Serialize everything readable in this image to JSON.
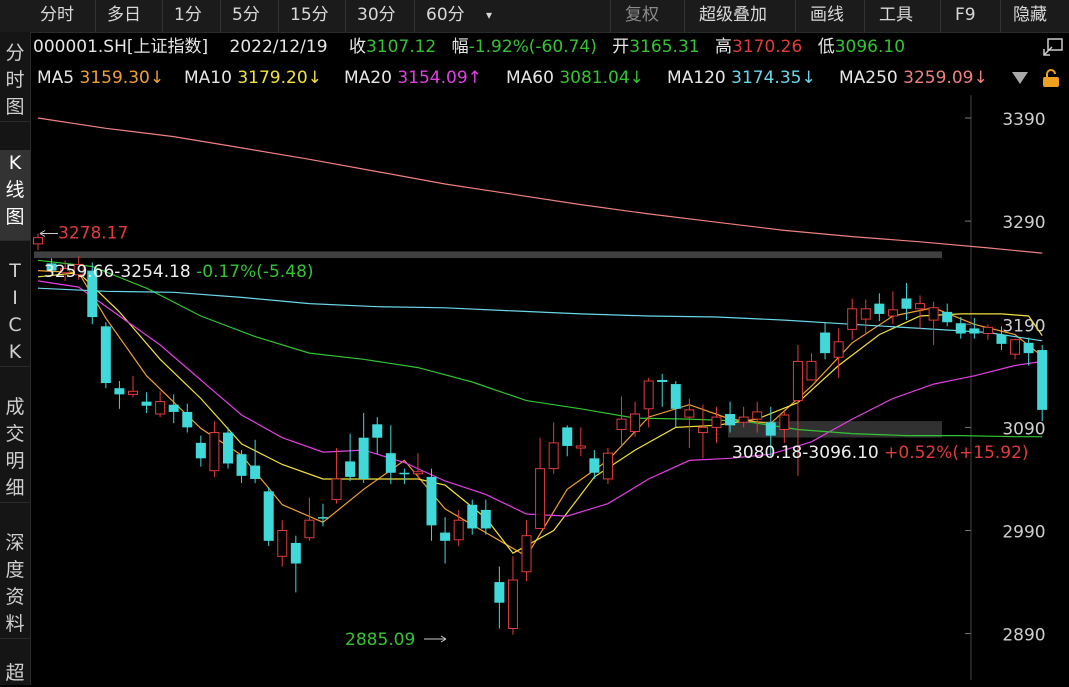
{
  "toolbar": {
    "items": [
      "分时",
      "多日",
      "1分",
      "5分",
      "15分",
      "30分",
      "60分"
    ],
    "dropdown_icon": "caret-down-icon",
    "right_items": [
      "复权",
      "超级叠加",
      "画线",
      "工具",
      "F9",
      "隐藏"
    ]
  },
  "sidebar": {
    "tabs": [
      "分\n时\n图",
      "K\n线\n图",
      "T\nI\nC\nK",
      "成\n交\n明\n细",
      "深\n度\n资\n料",
      "超"
    ]
  },
  "header": {
    "code": "000001.SH[上证指数]",
    "date": "2022/12/19",
    "close_label": "收",
    "close": "3107.12",
    "change_label": "幅",
    "change": "-1.92%(-60.74)",
    "open_label": "开",
    "open": "3165.31",
    "high_label": "高",
    "high": "3170.26",
    "low_label": "低",
    "low": "3096.10",
    "restore_icon": "restore-window-icon"
  },
  "ma_bar": {
    "items": [
      {
        "label": "MA5",
        "value": "3159.30↓",
        "color": "#f0a030"
      },
      {
        "label": "MA10",
        "value": "3179.20↓",
        "color": "#f2e23c"
      },
      {
        "label": "MA20",
        "value": "3154.09↑",
        "color": "#e040e0"
      },
      {
        "label": "MA60",
        "value": "3081.04↓",
        "color": "#33c333"
      },
      {
        "label": "MA120",
        "value": "3174.35↓",
        "color": "#6ad8e8"
      },
      {
        "label": "MA250",
        "value": "3259.09↓",
        "color": "#f08080"
      }
    ],
    "menu_icon": "triangle-down-icon",
    "lock_icon": "lock-icon"
  },
  "colors": {
    "up": "#e03c3c",
    "down": "#40d8d8",
    "background": "#000000"
  },
  "chart_data": {
    "type": "candlestick",
    "yticks": [
      3390,
      3290,
      3190,
      3090,
      2990,
      2890
    ],
    "ylim": [
      2870,
      3405
    ],
    "annotations": {
      "high_marker": "3278.17",
      "low_marker": "2885.09",
      "upper_range": "3259.66-3254.18",
      "upper_pct": "-0.17%(-5.48)",
      "lower_range": "3080.18-3096.10",
      "lower_pct": "+0.52%(+15.92)"
    },
    "band_levels": [
      3259.66,
      3254.18,
      3096.1,
      3080.18
    ],
    "candles": [
      [
        3268,
        3274,
        3278,
        3262
      ],
      [
        3249,
        3242,
        3254,
        3240
      ],
      [
        3240,
        3244,
        3252,
        3232
      ],
      [
        3238,
        3248,
        3256,
        3233
      ],
      [
        3242,
        3197,
        3250,
        3190
      ],
      [
        3188,
        3133,
        3192,
        3128
      ],
      [
        3128,
        3122,
        3135,
        3108
      ],
      [
        3122,
        3125,
        3140,
        3119
      ],
      [
        3115,
        3111,
        3124,
        3104
      ],
      [
        3103,
        3115,
        3125,
        3100
      ],
      [
        3112,
        3105,
        3122,
        3094
      ],
      [
        3105,
        3090,
        3113,
        3085
      ],
      [
        3075,
        3060,
        3082,
        3052
      ],
      [
        3048,
        3085,
        3096,
        3042
      ],
      [
        3085,
        3055,
        3090,
        3050
      ],
      [
        3064,
        3043,
        3068,
        3036
      ],
      [
        3053,
        3040,
        3078,
        3036
      ],
      [
        3028,
        2980,
        3032,
        2975
      ],
      [
        2965,
        2990,
        3000,
        2955
      ],
      [
        2978,
        2958,
        2985,
        2930
      ],
      [
        2983,
        3000,
        3022,
        2980
      ],
      [
        3003,
        3002,
        3016,
        2994
      ],
      [
        3020,
        3040,
        3070,
        3016
      ],
      [
        3057,
        3042,
        3084,
        3038
      ],
      [
        3080,
        3040,
        3104,
        3036
      ],
      [
        3093,
        3080,
        3100,
        3064
      ],
      [
        3065,
        3046,
        3092,
        3035
      ],
      [
        3046,
        3045,
        3050,
        3035
      ],
      [
        3045,
        3047,
        3065,
        3039
      ],
      [
        3042,
        2995,
        3050,
        2980
      ],
      [
        2988,
        2980,
        3003,
        2958
      ],
      [
        2981,
        3000,
        3010,
        2975
      ],
      [
        3015,
        2992,
        3020,
        2986
      ],
      [
        3010,
        2992,
        3020,
        2986
      ],
      [
        2940,
        2920,
        2955,
        2895
      ],
      [
        2895,
        2942,
        2965,
        2889
      ],
      [
        2950,
        2985,
        3000,
        2941
      ],
      [
        2992,
        3050,
        3080,
        3001
      ],
      [
        3050,
        3075,
        3095,
        3045
      ],
      [
        3090,
        3072,
        3092,
        3062
      ],
      [
        3070,
        3072,
        3090,
        3062
      ],
      [
        3060,
        3046,
        3068,
        3040
      ],
      [
        3040,
        3065,
        3070,
        3035
      ],
      [
        3088,
        3098,
        3120,
        3072
      ],
      [
        3086,
        3103,
        3115,
        3081
      ],
      [
        3108,
        3135,
        3138,
        3090
      ],
      [
        3136,
        3134,
        3142,
        3110
      ],
      [
        3132,
        3108,
        3135,
        3090
      ],
      [
        3100,
        3107,
        3118,
        3070
      ],
      [
        3085,
        3090,
        3112,
        3060
      ],
      [
        3090,
        3100,
        3110,
        3075
      ],
      [
        3103,
        3092,
        3115,
        3085
      ],
      [
        3095,
        3100,
        3110,
        3090
      ],
      [
        3098,
        3105,
        3115,
        3085
      ],
      [
        3095,
        3082,
        3110,
        3062
      ],
      [
        3088,
        3102,
        3105,
        3075
      ],
      [
        3116,
        3154,
        3170,
        3043
      ],
      [
        3136,
        3154,
        3162,
        3140
      ],
      [
        3182,
        3162,
        3192,
        3156
      ],
      [
        3158,
        3173,
        3186,
        3138
      ],
      [
        3185,
        3205,
        3215,
        3175
      ],
      [
        3195,
        3205,
        3214,
        3180
      ],
      [
        3210,
        3200,
        3220,
        3193
      ],
      [
        3198,
        3204,
        3222,
        3190
      ],
      [
        3215,
        3205,
        3230,
        3194
      ],
      [
        3205,
        3210,
        3218,
        3185
      ],
      [
        3194,
        3206,
        3212,
        3170
      ],
      [
        3202,
        3192,
        3210,
        3188
      ],
      [
        3191,
        3181,
        3197,
        3176
      ],
      [
        3186,
        3181,
        3196,
        3176
      ],
      [
        3181,
        3187,
        3190,
        3175
      ],
      [
        3180,
        3171,
        3188,
        3165
      ],
      [
        3161,
        3175,
        3176,
        3156
      ],
      [
        3172,
        3162,
        3177,
        3150
      ],
      [
        3165,
        3107,
        3170,
        3096
      ]
    ],
    "ma": {
      "MA5": [
        [
          0,
          3242
        ],
        [
          3,
          3240
        ],
        [
          5,
          3196
        ],
        [
          8,
          3140
        ],
        [
          12,
          3089
        ],
        [
          15,
          3063
        ],
        [
          18,
          3015
        ],
        [
          21,
          2998
        ],
        [
          24,
          3030
        ],
        [
          27,
          3058
        ],
        [
          30,
          3011
        ],
        [
          33,
          2988
        ],
        [
          36,
          2965
        ],
        [
          39,
          3030
        ],
        [
          42,
          3058
        ],
        [
          45,
          3100
        ],
        [
          48,
          3112
        ],
        [
          51,
          3098
        ],
        [
          54,
          3094
        ],
        [
          57,
          3130
        ],
        [
          60,
          3172
        ],
        [
          63,
          3198
        ],
        [
          66,
          3206
        ],
        [
          69,
          3190
        ],
        [
          72,
          3180
        ],
        [
          74,
          3159
        ]
      ],
      "MA10": [
        [
          0,
          3236
        ],
        [
          3,
          3240
        ],
        [
          6,
          3202
        ],
        [
          9,
          3156
        ],
        [
          12,
          3118
        ],
        [
          15,
          3074
        ],
        [
          18,
          3054
        ],
        [
          21,
          3040
        ],
        [
          24,
          3040
        ],
        [
          28,
          3040
        ],
        [
          30,
          3034
        ],
        [
          33,
          3002
        ],
        [
          35,
          2968
        ],
        [
          38,
          2990
        ],
        [
          41,
          3042
        ],
        [
          44,
          3068
        ],
        [
          47,
          3090
        ],
        [
          50,
          3092
        ],
        [
          53,
          3098
        ],
        [
          56,
          3114
        ],
        [
          59,
          3150
        ],
        [
          62,
          3180
        ],
        [
          65,
          3198
        ],
        [
          68,
          3200
        ],
        [
          71,
          3200
        ],
        [
          73,
          3198
        ],
        [
          74,
          3179
        ]
      ],
      "MA20": [
        [
          0,
          3232
        ],
        [
          3,
          3226
        ],
        [
          6,
          3198
        ],
        [
          9,
          3170
        ],
        [
          12,
          3136
        ],
        [
          15,
          3102
        ],
        [
          18,
          3080
        ],
        [
          21,
          3066
        ],
        [
          24,
          3068
        ],
        [
          27,
          3056
        ],
        [
          30,
          3038
        ],
        [
          33,
          3025
        ],
        [
          36,
          3006
        ],
        [
          39,
          3004
        ],
        [
          42,
          3016
        ],
        [
          45,
          3040
        ],
        [
          48,
          3058
        ],
        [
          51,
          3060
        ],
        [
          54,
          3064
        ],
        [
          57,
          3076
        ],
        [
          60,
          3098
        ],
        [
          63,
          3118
        ],
        [
          66,
          3132
        ],
        [
          69,
          3140
        ],
        [
          72,
          3150
        ],
        [
          74,
          3154
        ]
      ],
      "MA60": [
        [
          0,
          3252
        ],
        [
          4,
          3246
        ],
        [
          8,
          3225
        ],
        [
          12,
          3198
        ],
        [
          16,
          3178
        ],
        [
          20,
          3162
        ],
        [
          24,
          3156
        ],
        [
          28,
          3148
        ],
        [
          32,
          3134
        ],
        [
          36,
          3116
        ],
        [
          40,
          3108
        ],
        [
          44,
          3099
        ],
        [
          48,
          3098
        ],
        [
          52,
          3096
        ],
        [
          56,
          3088
        ],
        [
          60,
          3084
        ],
        [
          64,
          3082
        ],
        [
          68,
          3082
        ],
        [
          72,
          3081
        ],
        [
          74,
          3081
        ]
      ],
      "MA120": [
        [
          0,
          3225
        ],
        [
          5,
          3222
        ],
        [
          10,
          3221
        ],
        [
          15,
          3216
        ],
        [
          20,
          3210
        ],
        [
          25,
          3207
        ],
        [
          30,
          3206
        ],
        [
          35,
          3203
        ],
        [
          40,
          3200
        ],
        [
          45,
          3198
        ],
        [
          50,
          3197
        ],
        [
          55,
          3194
        ],
        [
          60,
          3190
        ],
        [
          65,
          3186
        ],
        [
          70,
          3182
        ],
        [
          74,
          3174
        ]
      ],
      "MA250": [
        [
          0,
          3390
        ],
        [
          5,
          3380
        ],
        [
          10,
          3372
        ],
        [
          15,
          3361
        ],
        [
          20,
          3350
        ],
        [
          25,
          3338
        ],
        [
          30,
          3326
        ],
        [
          35,
          3316
        ],
        [
          40,
          3306
        ],
        [
          45,
          3297
        ],
        [
          50,
          3289
        ],
        [
          55,
          3281
        ],
        [
          60,
          3275
        ],
        [
          65,
          3270
        ],
        [
          70,
          3264
        ],
        [
          74,
          3259
        ]
      ]
    }
  }
}
